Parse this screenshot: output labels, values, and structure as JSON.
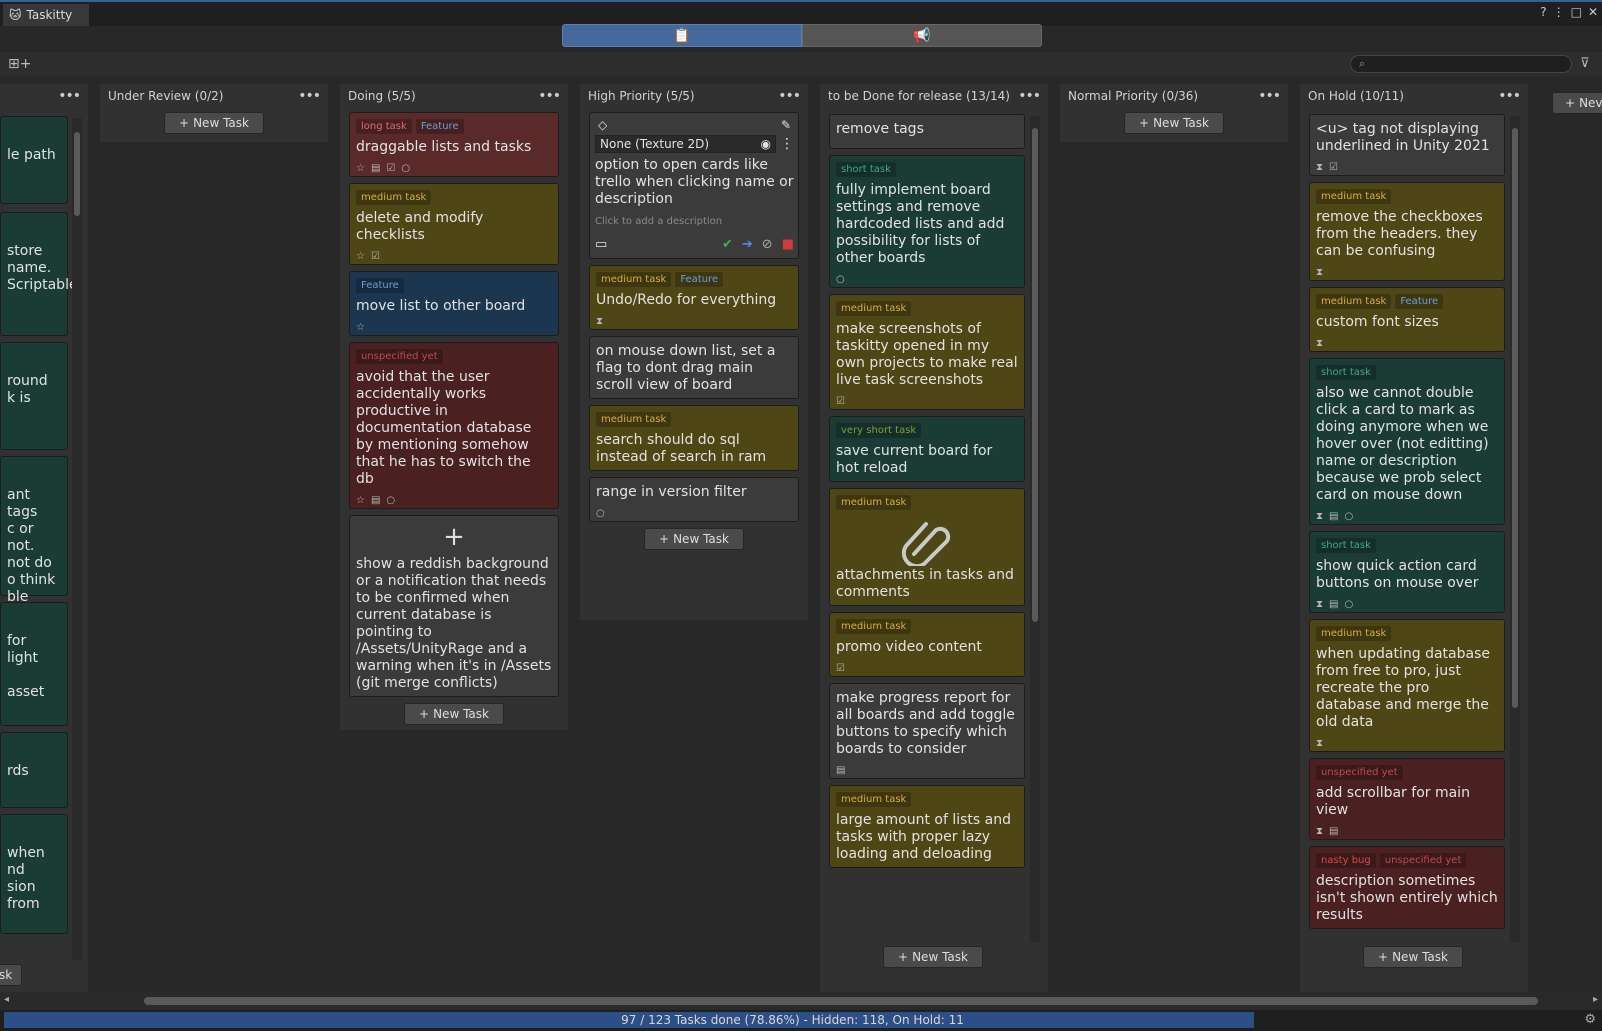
{
  "window": {
    "title": "Taskitty"
  },
  "toolbar": {
    "tab1_icon": "clipboard-icon",
    "tab2_icon": "megaphone-icon",
    "search_placeholder": ""
  },
  "lists": {
    "partial": {
      "new_task": "sk",
      "cards": [
        {
          "text": "le path"
        },
        {
          "text": "store\nname.\nScriptable"
        },
        {
          "text": "round\nk is"
        },
        {
          "text": "ant tags\nc or not.\nnot do\no think\nble"
        },
        {
          "text": "for light\n\nasset"
        },
        {
          "text": "rds"
        },
        {
          "text": "when\nnd\nsion from"
        }
      ]
    },
    "under_review": {
      "title": "Under Review (0/2)",
      "new_task": "New Task"
    },
    "doing": {
      "title": "Doing (5/5)",
      "new_task": "New Task",
      "cards": [
        {
          "tags": [
            "long task",
            "Feature"
          ],
          "text": "draggable lists and tasks"
        },
        {
          "tags": [
            "medium task"
          ],
          "text": "delete and modify checklists"
        },
        {
          "tags": [
            "Feature"
          ],
          "text": "move list to other board"
        },
        {
          "tags": [
            "unspecified yet"
          ],
          "text": "avoid that the user accidentally works productive in documentation database by mentioning somehow that he has to switch the db"
        },
        {
          "plus": "+",
          "text": "show a reddish background or a notification that needs to be confirmed when current database is pointing to /Assets/UnityRage and a warning when it's in /Assets (git merge conflicts)"
        }
      ]
    },
    "high_priority": {
      "title": "High Priority (5/5)",
      "new_task": "New Task",
      "edit_card": {
        "texture": "None (Texture 2D)",
        "text": "option to open cards like trello when clicking name or description",
        "desc_placeholder": "Click to add a description"
      },
      "cards": [
        {
          "tags": [
            "medium task",
            "Feature"
          ],
          "text": "Undo/Redo for everything"
        },
        {
          "tags": [],
          "text": "on mouse down list, set a flag to dont drag main scroll view of board"
        },
        {
          "tags": [
            "medium task"
          ],
          "text": "search should do sql instead of search in ram"
        },
        {
          "tags": [],
          "text": "range in version filter"
        }
      ]
    },
    "release": {
      "title": "to be Done for release (13/14)",
      "new_task": "New Task",
      "cards": [
        {
          "tags": [],
          "text": "remove tags"
        },
        {
          "tags": [
            "short task"
          ],
          "text": "fully implement board settings and remove hardcoded lists and add possibility for lists of other boards"
        },
        {
          "tags": [
            "medium task"
          ],
          "text": "make screenshots of taskitty opened in my own projects to make real live task screenshots"
        },
        {
          "tags": [
            "very short task"
          ],
          "text": "save current board for hot reload"
        },
        {
          "tags": [
            "medium task"
          ],
          "text": "attachments in tasks and comments"
        },
        {
          "tags": [
            "medium task"
          ],
          "text": "promo video content"
        },
        {
          "tags": [],
          "text": "make progress report for all boards and add toggle buttons to specify which boards to consider"
        },
        {
          "tags": [
            "medium task"
          ],
          "text": "large amount of lists and tasks with proper lazy loading and deloading"
        }
      ]
    },
    "normal_priority": {
      "title": "Normal Priority (0/36)",
      "new_task": "New Task"
    },
    "on_hold": {
      "title": "On Hold (10/11)",
      "new_task": "New Task",
      "cards": [
        {
          "tags": [],
          "text": "<u> tag not displaying underlined in Unity 2021"
        },
        {
          "tags": [
            "medium task"
          ],
          "text": "remove the checkboxes from the headers. they can be confusing"
        },
        {
          "tags": [
            "medium task",
            "Feature"
          ],
          "text": "custom font sizes"
        },
        {
          "tags": [
            "short task"
          ],
          "text": "also we cannot double click a card to mark as doing anymore when we hover over (not editting) name or description because we prob select card on mouse down"
        },
        {
          "tags": [
            "short task"
          ],
          "text": "show quick action card buttons on mouse over"
        },
        {
          "tags": [
            "medium task"
          ],
          "text": "when updating database from free to pro, just recreate the pro database and merge the old data"
        },
        {
          "tags": [
            "unspecified yet"
          ],
          "text": "add scrollbar for main view"
        },
        {
          "tags": [
            "nasty bug",
            "unspecified yet"
          ],
          "text": "description sometimes isn't shown entirely which results"
        }
      ]
    },
    "next": {
      "new_task": "Nev"
    }
  },
  "status": {
    "text": "97 / 123 Tasks done (78.86%) - Hidden: 118, On Hold: 11",
    "progress": 0.7886
  }
}
